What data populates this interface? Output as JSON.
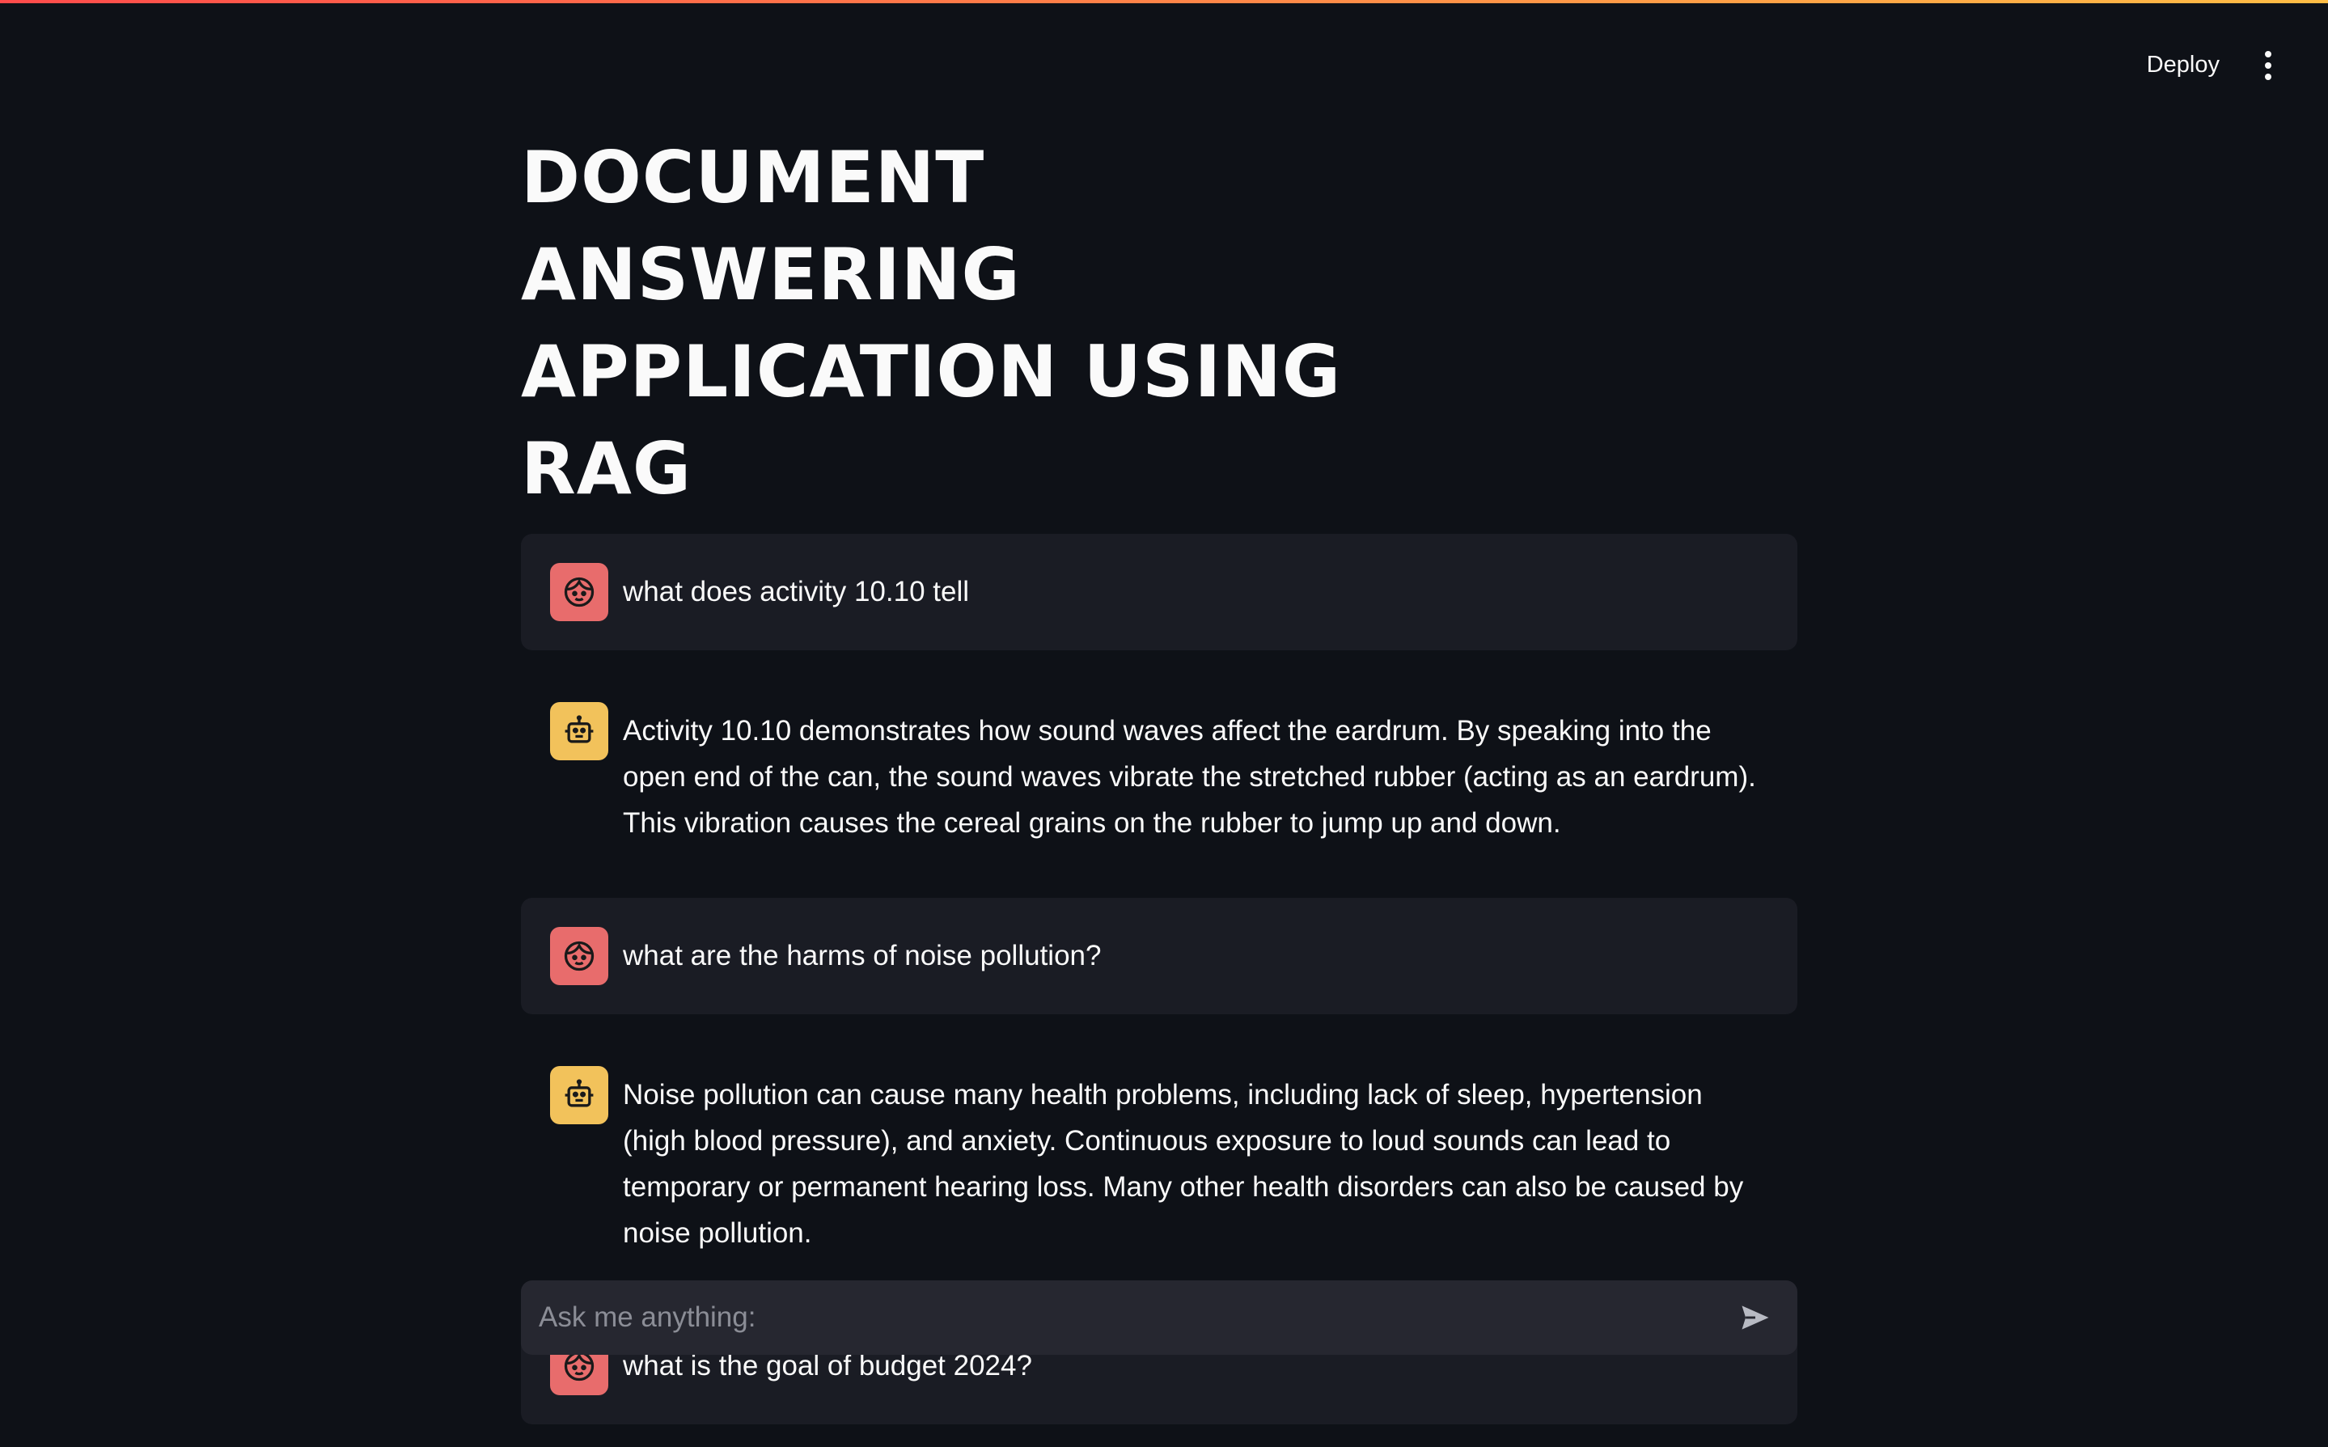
{
  "header": {
    "deploy_label": "Deploy"
  },
  "page": {
    "title": "DOCUMENT ANSWERING APPLICATION USING RAG"
  },
  "chat": {
    "messages": [
      {
        "role": "user",
        "avatar_icon": "user-face-icon",
        "text": "what does activity 10.10 tell"
      },
      {
        "role": "assistant",
        "avatar_icon": "robot-icon",
        "text": "Activity 10.10 demonstrates how sound waves affect the eardrum. By speaking into the open end of the can, the sound waves vibrate the stretched rubber (acting as an eardrum). This vibration causes the cereal grains on the rubber to jump up and down."
      },
      {
        "role": "user",
        "avatar_icon": "user-face-icon",
        "text": "what are the harms of noise pollution?"
      },
      {
        "role": "assistant",
        "avatar_icon": "robot-icon",
        "text": "Noise pollution can cause many health problems, including lack of sleep, hypertension (high blood pressure), and anxiety. Continuous exposure to loud sounds can lead to temporary or permanent hearing loss. Many other health disorders can also be caused by noise pollution."
      },
      {
        "role": "user",
        "avatar_icon": "user-face-icon",
        "text": "what is the goal of budget 2024?"
      }
    ]
  },
  "input": {
    "placeholder": "Ask me anything:",
    "value": ""
  },
  "colors": {
    "background": "#0e1117",
    "user_message_bg": "#1a1c24",
    "user_avatar": "#e86c6c",
    "assistant_avatar": "#f2c25b",
    "input_bg": "#262730",
    "accent_gradient_start": "#ff4b4b",
    "accent_gradient_end": "#ffbd45"
  }
}
